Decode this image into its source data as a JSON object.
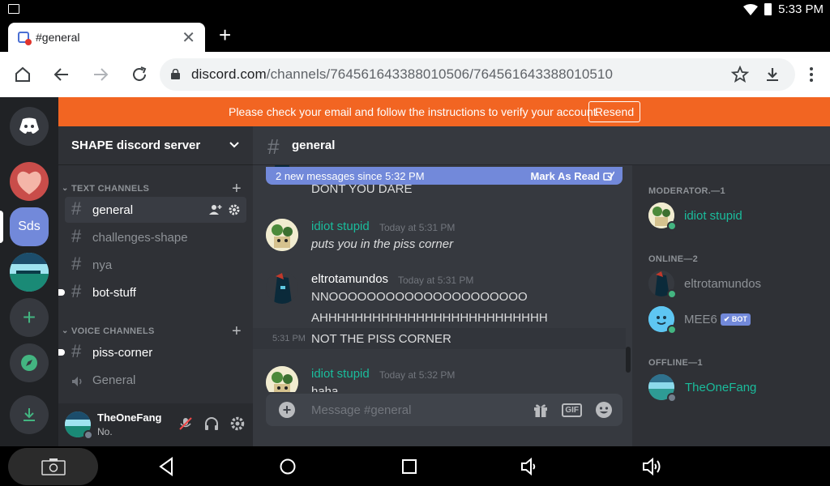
{
  "statusbar": {
    "time": "5:33 PM"
  },
  "browser": {
    "tab_title": "#general",
    "url_host": "discord.com",
    "url_path": "/channels/764561643388010506/764561643388010510"
  },
  "banner": {
    "message": "Please check your email and follow the instructions to verify your account.",
    "resend_label": "Resend"
  },
  "guilds": {
    "server_abbr": "Sds"
  },
  "server": {
    "name": "SHAPE discord server"
  },
  "categories": {
    "text": "TEXT CHANNELS",
    "voice": "VOICE CHANNELS"
  },
  "channels": [
    {
      "name": "general"
    },
    {
      "name": "challenges-shape"
    },
    {
      "name": "nya"
    },
    {
      "name": "bot-stuff"
    },
    {
      "name": "piss-corner"
    },
    {
      "name": "General"
    }
  ],
  "user": {
    "name": "TheOneFang",
    "status": "No."
  },
  "chat": {
    "channel": "general",
    "new_messages": "2 new messages since 5:32 PM",
    "mark_as_read": "Mark As Read",
    "placeholder": "Message #general"
  },
  "messages": [
    {
      "text": "DONT YOU DARE"
    },
    {
      "author": "idiot stupid",
      "time": "Today at 5:31 PM",
      "text": "puts you in the piss corner"
    },
    {
      "author": "eltrotamundos",
      "time": "Today at 5:31 PM",
      "lines": [
        "NNOOOOOOOOOOOOOOOOOOOOO",
        "AHHHHHHHHHHHHHHHHHHHHHHHHHH"
      ]
    },
    {
      "time": "5:31 PM",
      "text": "NOT THE PISS CORNER"
    },
    {
      "author": "idiot stupid",
      "time": "Today at 5:32 PM",
      "text": "haha"
    }
  ],
  "members": {
    "moderator_header": "MODERATOR.—1",
    "online_header": "ONLINE—2",
    "offline_header": "OFFLINE—1",
    "list": [
      {
        "name": "idiot stupid"
      },
      {
        "name": "eltrotamundos"
      },
      {
        "name": "MEE6",
        "badge": "BOT"
      },
      {
        "name": "TheOneFang"
      }
    ]
  },
  "colors": {
    "banner": "#f26522",
    "blurple": "#7289da",
    "mod_name": "#1abc9c",
    "online": "#43b581"
  }
}
